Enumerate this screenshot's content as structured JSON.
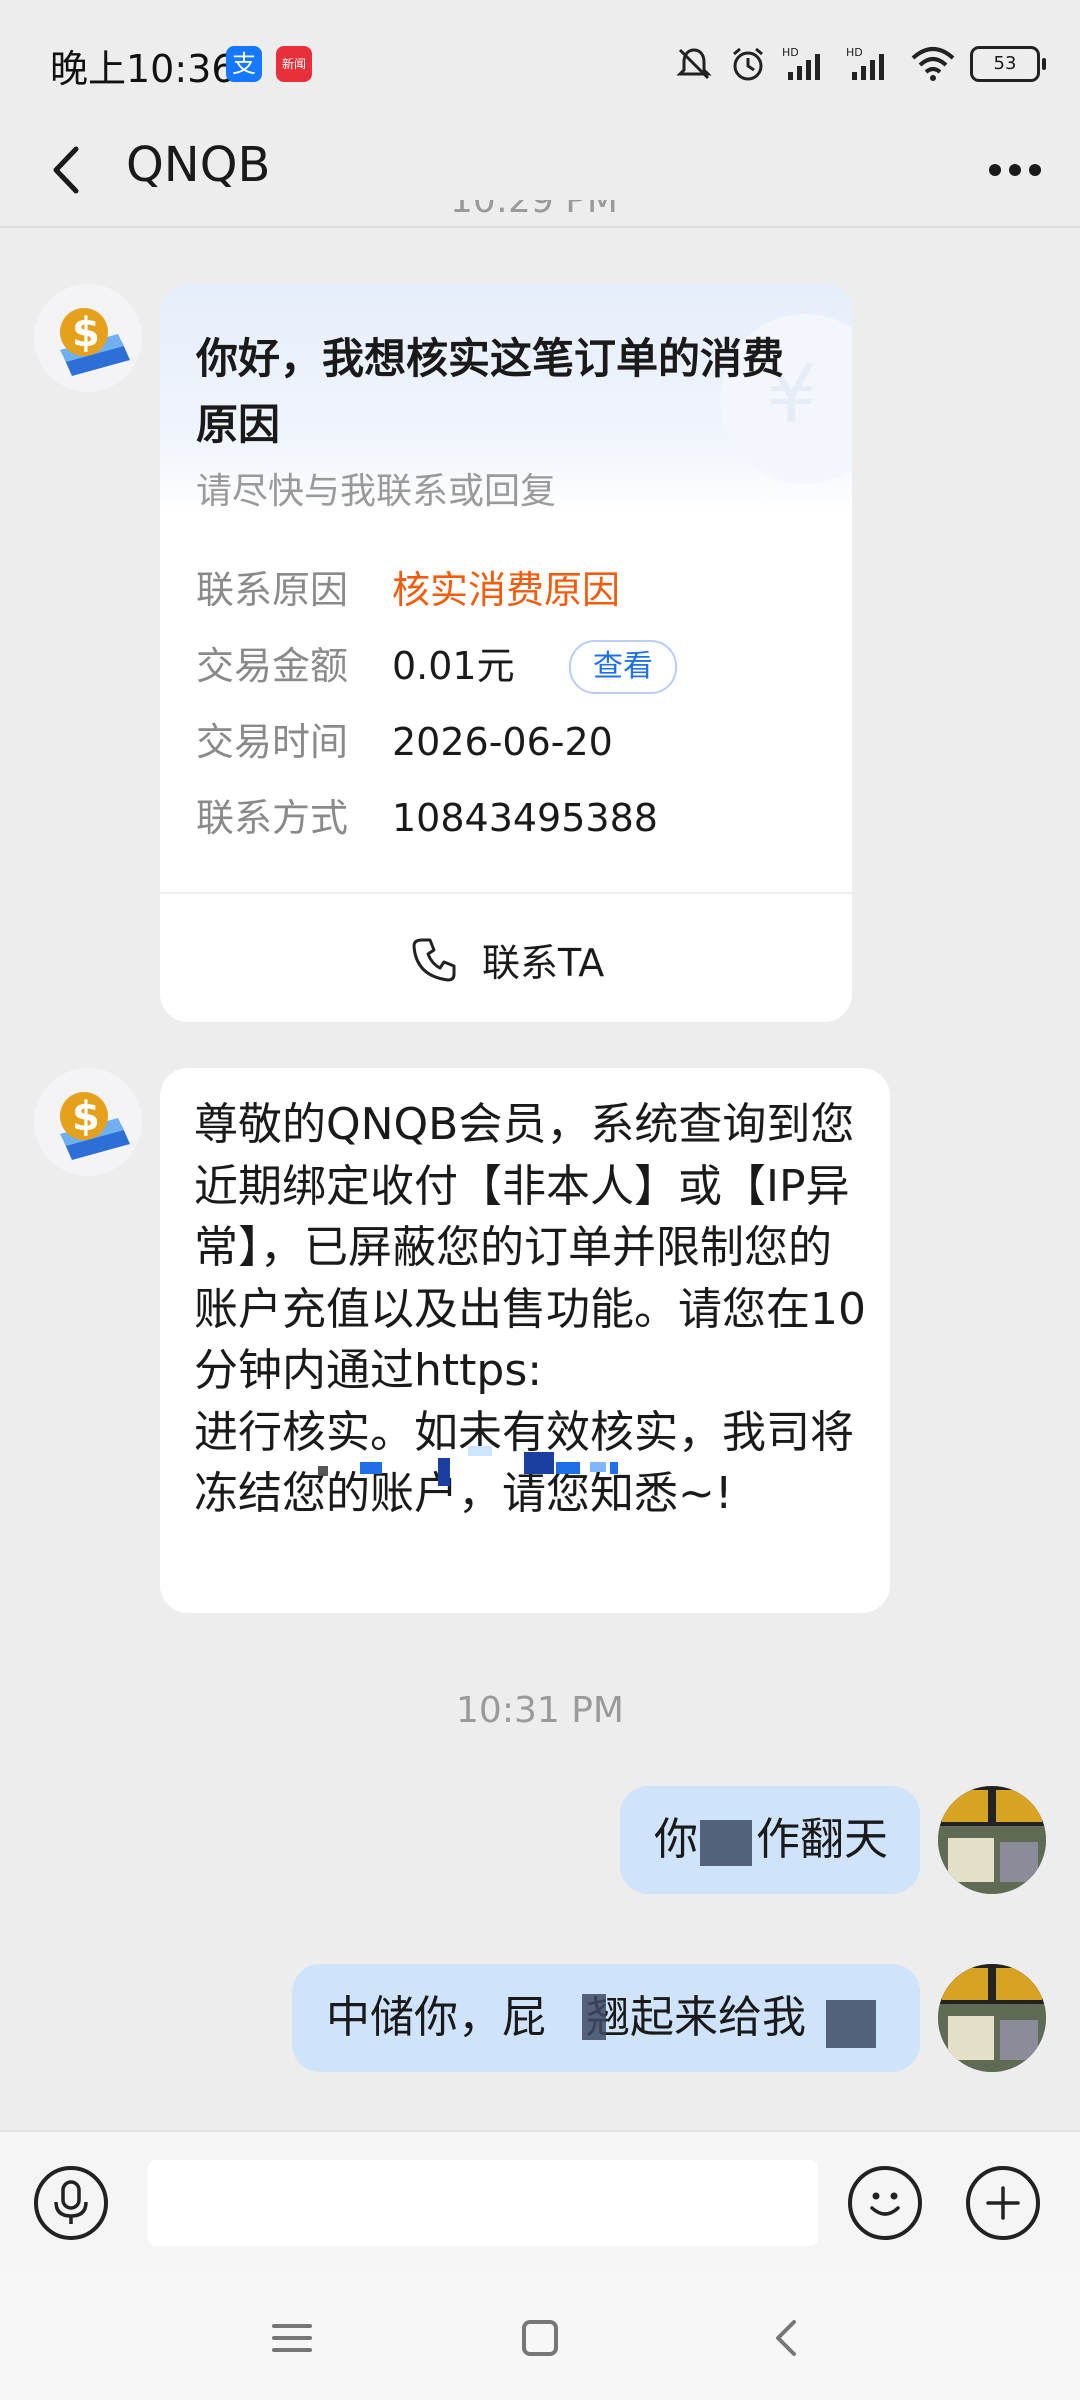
{
  "status_bar": {
    "time": "晚上10:36",
    "alipay_glyph": "支",
    "news_app_label": "新闻",
    "battery": "53",
    "icons": [
      "mute-icon",
      "alarm-icon",
      "hd-signal-icon",
      "hd-signal-icon",
      "wifi-icon",
      "battery-icon"
    ]
  },
  "header": {
    "title": "QNQB",
    "cut_timestamp": "10:29 PM"
  },
  "card": {
    "title": "你好，我想核实这笔订单的消费原因",
    "subtitle": "请尽快与我联系或回复",
    "watermark": "¥",
    "rows": [
      {
        "label": "联系原因",
        "value": "核实消费原因"
      },
      {
        "label": "交易金额",
        "value": "0.01元"
      },
      {
        "label": "交易时间",
        "value": "2026-06-20"
      },
      {
        "label": "联系方式",
        "value": "10843495388"
      }
    ],
    "view_button": "查看",
    "contact_button": "联系TA"
  },
  "message": {
    "text_before_link": "尊敬的QNQB会员，系统查询到您近期绑定收付【非本人】或【IP异常】，已屏蔽您的订单并限制您的账户充值以及出售功能。请您在10分钟内通过https:",
    "text_after_link": "进行核实。如未有效核实，我司将冻结您的账户，请您知悉~!"
  },
  "timestamp": "10:31 PM",
  "outgoing": [
    {
      "prefix": "你",
      "suffix": "作翻天"
    },
    {
      "prefix": "中储你，屁",
      "middle": "翘起来给我",
      "suffix": ""
    }
  ],
  "input": {
    "placeholder": ""
  },
  "colors": {
    "background": "#ededed",
    "accent_orange": "#f25c0f",
    "link_blue": "#1f6fe6",
    "outgoing_bubble": "#cfe3fb"
  }
}
